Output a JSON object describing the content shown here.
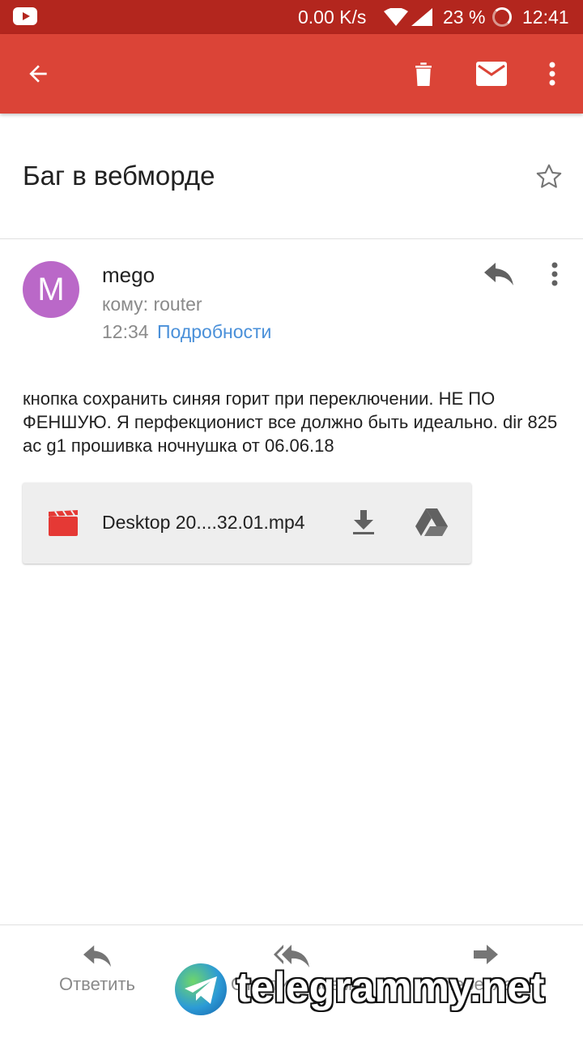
{
  "status_bar": {
    "network_speed": "0.00 K/s",
    "battery_percent": "23 %",
    "time": "12:41"
  },
  "app_bar": {
    "back_icon": "arrow-left-icon",
    "delete_icon": "trash-icon",
    "mail_icon": "envelope-icon",
    "overflow_icon": "more-vert-icon"
  },
  "email": {
    "subject": "Баг в вебморде",
    "sender": {
      "initial": "M",
      "name": "mego",
      "avatar_color": "#ba68c8"
    },
    "recipient": "кому: router",
    "time": "12:34",
    "details_link": "Подробности",
    "body": "кнопка сохранить синяя горит при переключении. НЕ ПО ФЕНШУЮ. Я перфекционист все должно быть идеально. dir 825 ac g1 прошивка ночнушка от 06.06.18",
    "attachment": {
      "file_name": "Desktop 20....32.01.mp4",
      "file_icon": "video-clapper-icon",
      "download_icon": "download-icon",
      "drive_icon": "drive-icon"
    }
  },
  "bottom_actions": {
    "reply": "Ответить",
    "reply_all": "Ответить всем",
    "forward": "Переслать"
  },
  "watermark": {
    "text": "telegrammy.net"
  },
  "colors": {
    "status_bar": "#b3261e",
    "app_bar": "#db4437",
    "link": "#4a90d9",
    "video_icon": "#e53935"
  }
}
